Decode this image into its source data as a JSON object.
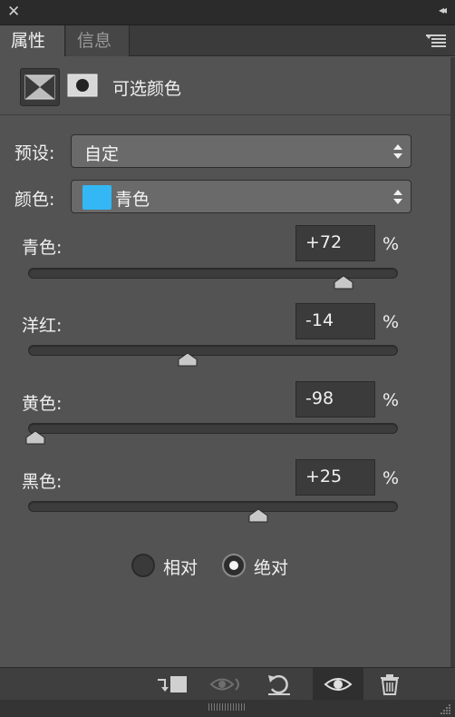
{
  "tabs": [
    {
      "label": "属性",
      "active": true
    },
    {
      "label": "信息",
      "active": false
    }
  ],
  "header": {
    "title": "可选颜色"
  },
  "preset": {
    "label": "预设:",
    "value": "自定"
  },
  "color": {
    "label": "颜色:",
    "value": "青色",
    "swatch": "#33b8f5"
  },
  "sliders": [
    {
      "label": "青色:",
      "value": "+72",
      "unit": "%",
      "level": 72
    },
    {
      "label": "洋红:",
      "value": "-14",
      "unit": "%",
      "level": -14
    },
    {
      "label": "黄色:",
      "value": "-98",
      "unit": "%",
      "level": -98
    },
    {
      "label": "黑色:",
      "value": "+25",
      "unit": "%",
      "level": 25
    }
  ],
  "method": {
    "relative": "相对",
    "absolute": "绝对",
    "selected": "absolute"
  },
  "icons": {
    "close": "close-icon",
    "collapse": "double-chevron-icon",
    "panel_menu": "panel-menu-icon",
    "clip": "clip-to-layer-icon",
    "view_previous": "view-previous-state-icon",
    "reset": "reset-icon",
    "visibility": "eye-icon",
    "delete": "trash-icon"
  }
}
